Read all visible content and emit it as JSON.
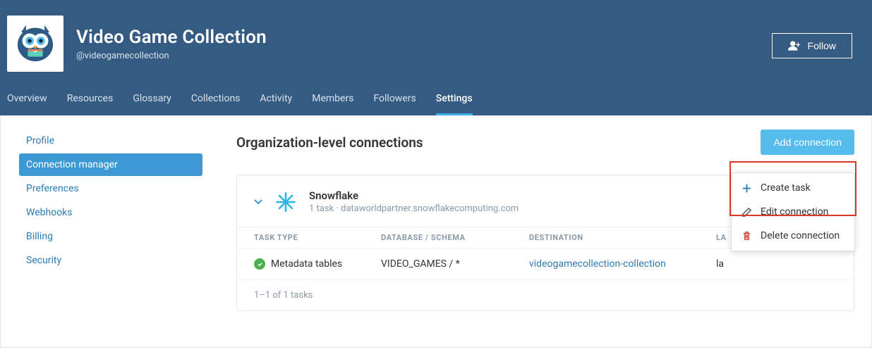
{
  "header": {
    "org_name": "Video Game Collection",
    "handle": "@videogamecollection",
    "follow_label": "Follow",
    "tabs": [
      "Overview",
      "Resources",
      "Glossary",
      "Collections",
      "Activity",
      "Members",
      "Followers",
      "Settings"
    ],
    "active_tab": 7
  },
  "sidebar": {
    "items": [
      "Profile",
      "Connection manager",
      "Preferences",
      "Webhooks",
      "Billing",
      "Security"
    ],
    "active": 1
  },
  "main": {
    "title": "Organization-level connections",
    "add_label": "Add connection"
  },
  "connection": {
    "name": "Snowflake",
    "subtitle": "1 task  ·  dataworldpartner.snowflakecomputing.com",
    "columns": {
      "type": "TASK TYPE",
      "db": "DATABASE / SCHEMA",
      "dest": "DESTINATION",
      "last": "LA"
    },
    "row": {
      "type": "Metadata tables",
      "db": "VIDEO_GAMES / *",
      "dest": "videogamecollection-collection",
      "last": "la"
    },
    "footer": "1–1 of 1 tasks"
  },
  "menu": {
    "create": "Create task",
    "edit": "Edit connection",
    "delete": "Delete connection"
  }
}
